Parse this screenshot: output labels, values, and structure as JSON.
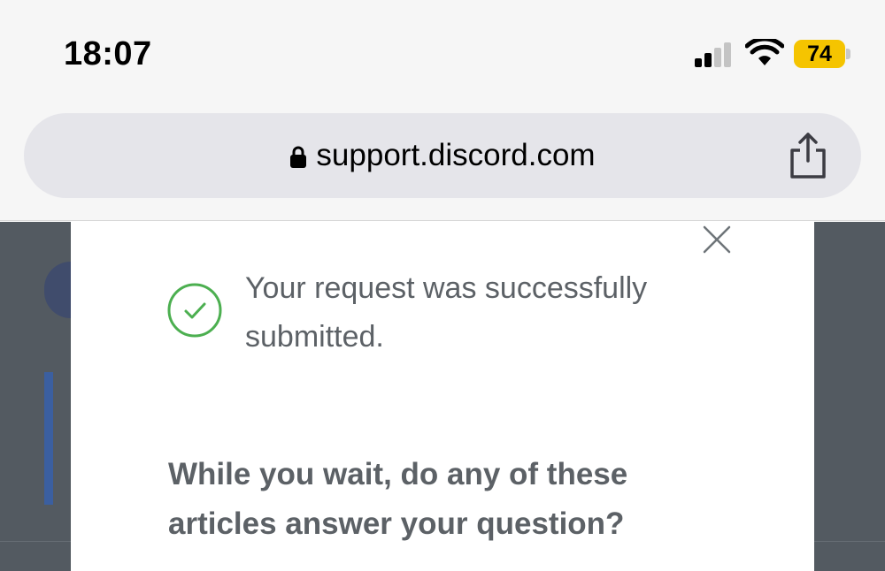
{
  "status_bar": {
    "time": "18:07",
    "battery": "74",
    "icons": [
      "cellular-signal-icon",
      "wifi-icon",
      "battery-icon"
    ],
    "battery_color": "#f5c400"
  },
  "browser": {
    "url": "support.discord.com",
    "icons": [
      "lock-icon",
      "share-icon"
    ]
  },
  "modal": {
    "success_message": "Your request was successfully submitted.",
    "articles_prompt": "While you wait, do any of these articles answer your question?",
    "icons": [
      "close-icon",
      "success-check-icon"
    ],
    "success_color": "#4caf50",
    "backdrop_color": "#535a61"
  }
}
